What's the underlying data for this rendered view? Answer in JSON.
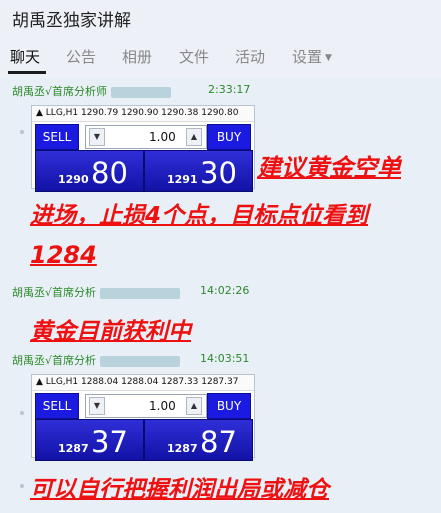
{
  "window": {
    "title": "胡禹丞独家讲解"
  },
  "tabs": [
    {
      "label": "聊天",
      "active": true
    },
    {
      "label": "公告"
    },
    {
      "label": "相册"
    },
    {
      "label": "文件"
    },
    {
      "label": "活动"
    },
    {
      "label": "设置"
    }
  ],
  "messages": [
    {
      "sender": "胡禹丞√首席分析师",
      "time": "2:33:17",
      "widget": {
        "title": "LLG,H1  1290.79 1290.90 1290.38 1290.80",
        "sell_label": "SELL",
        "buy_label": "BUY",
        "lot": "1.00",
        "sell_price_small": "1290",
        "sell_price_big": "80",
        "buy_price_small": "1291",
        "buy_price_big": "30"
      },
      "text_lines": [
        "建议黄金空单",
        "进场，止损4个点，目标点位看到",
        "1284"
      ]
    },
    {
      "sender": "胡禹丞√首席分析",
      "time": "14:02:26",
      "text_lines": [
        "黄金目前获利中"
      ]
    },
    {
      "sender": "胡禹丞√首席分析",
      "time": "14:03:51",
      "widget": {
        "title": "LLG,H1  1288.04 1288.04 1287.33 1287.37",
        "sell_label": "SELL",
        "buy_label": "BUY",
        "lot": "1.00",
        "sell_price_small": "1287",
        "sell_price_big": "37",
        "buy_price_small": "1287",
        "buy_price_big": "87"
      },
      "text_lines": [
        "可以自行把握利润出局或减仓"
      ]
    }
  ],
  "colors": {
    "accent_red": "#ee1111",
    "sender_green": "#2a8a2a",
    "button_blue": "#1a1ae0"
  }
}
